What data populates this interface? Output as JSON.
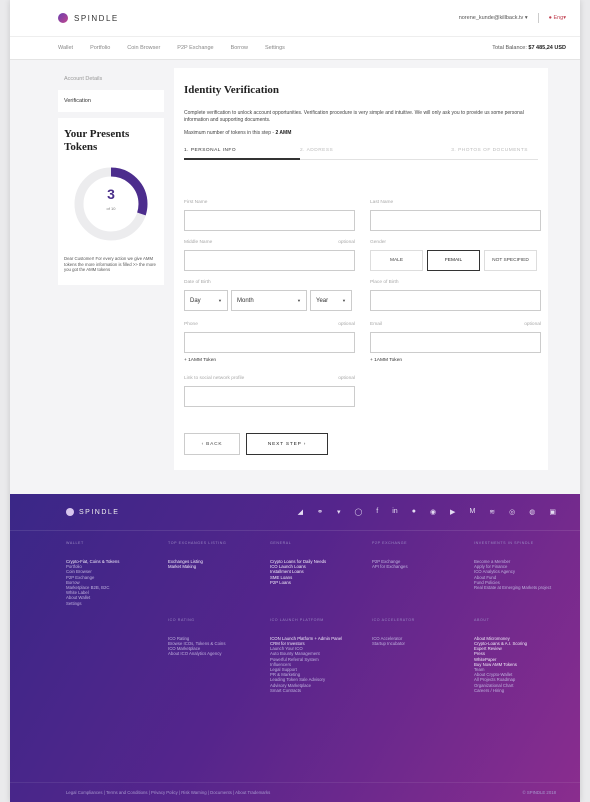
{
  "brand": "SPINDLE",
  "user_email": "norene_kunde@killback.tv",
  "lang": "Eng",
  "nav": [
    "Wallet",
    "Portfolio",
    "Coin Browser",
    "P2P Exchange",
    "Borrow",
    "Settings"
  ],
  "balance_label": "Total Balance:",
  "balance_value": "$7 485,24 USD",
  "side": {
    "account_label": "Account Details",
    "verification": "Verification",
    "tokens_title": "Your Presents Tokens",
    "tokens_value": "3",
    "tokens_of": "of 10",
    "tokens_progress": 0.3,
    "note": "Dear Customer! For every action we give AMM tokens the more information is filled >> the more you got the AMM tokens"
  },
  "form": {
    "title": "Identity Verification",
    "desc": "Complete verification to unlock account opportunities. Verification procedure is very simple and intuitive. We will only ask you to provide us some personal information and supporting documents.",
    "max_label": "Maximum number of tokens in this step -",
    "max_value": "2 AMM",
    "steps": [
      "1. PERSONAL INFO",
      "2. ADDRESS",
      "3. PHOTOS OF DOCUMENTS"
    ],
    "first_name": "First Name",
    "last_name": "Last Name",
    "middle_name": "Middle Name",
    "optional": "optional",
    "gender": "Gender",
    "gender_opts": [
      "MALE",
      "FEMAIL",
      "NOT SPECIFIED"
    ],
    "dob": "Date of Birth",
    "day": "Day",
    "month": "Month",
    "year": "Year",
    "pob": "Place of Birth",
    "phone": "Phone",
    "email": "Email",
    "token_plus": "+ 1AMM Token",
    "social": "Link to social network profile",
    "back": "BACK",
    "next": "NEXT STEP"
  },
  "footer": {
    "cols_top": [
      {
        "h": "WALLET",
        "items": [
          "Crypto-Fiat, Coins & Tokens",
          "Portfolio",
          "Coin Browser",
          "P2P Exchange",
          "Borrow",
          "Marketplace B2B, B2C",
          "White Label",
          "About Wallet",
          "Settings"
        ],
        "white": 1
      },
      {
        "h": "TOP EXCHANGES LISTING",
        "items": [
          "Exchanges Listing",
          "Market Making"
        ],
        "white": 2
      },
      {
        "h": "GENERAL",
        "items": [
          "Crypto Loans for Daily Needs",
          "ICO Launch Loans",
          "Installment Loans",
          "SME Loans",
          "P2P Loans"
        ],
        "white": 5
      },
      {
        "h": "P2P EXCHANGE",
        "items": [
          "P2P Exchange",
          "API for Exchanges"
        ],
        "white": 0
      },
      {
        "h": "INVESTMENTS IN SPINDLE",
        "items": [
          "Become a Member",
          "Apply for Finance",
          "ICO Analytics Agency",
          "About Fund",
          "Fund Policies",
          "Real Estate at Emerging Markets project"
        ],
        "white": 0
      }
    ],
    "cols_bottom": [
      {
        "h": "",
        "items": [],
        "white": 0
      },
      {
        "h": "ICO RATING",
        "items": [
          "ICO Rating",
          "Browse ICOs, Tokens & Coins",
          "ICO Marketplace",
          "About ICO Analytics Agency"
        ],
        "white": 0
      },
      {
        "h": "ICO LAUNCH PLATFORM",
        "items": [
          "ICON Launch Platform + Admin Panel",
          "CRM for Investors",
          "Launch Your ICO",
          "Auto Bounty Management",
          "Powerful Referral System",
          "Influencers",
          "Legal Support",
          "PR & Marketing",
          "Leading Token Sale Advisory",
          "Advisory Marketplace",
          "Smart Contracts"
        ],
        "white": 2
      },
      {
        "h": "ICO ACCELERATOR",
        "items": [
          "ICO Accelerator",
          "Startup Incubator"
        ],
        "white": 0
      },
      {
        "h": "ABOUT",
        "items": [
          "About Micromoney",
          "Crypto-Loans & A.I. Scoring",
          "Expert Review",
          "Press",
          "WhitePaper",
          "Buy Now AMM Tokens",
          "Team",
          "About Crypto-Wallet",
          "All Projects Roadmap",
          "Organizational Chart",
          "Careers / Hiring"
        ],
        "white": 6
      }
    ],
    "bottom_links": "Legal Compliances | Terms and Conditions | Privacy Policy | Risk Warning | Documents | About Trademarks",
    "copyright": "© SPINDLE 2018"
  }
}
